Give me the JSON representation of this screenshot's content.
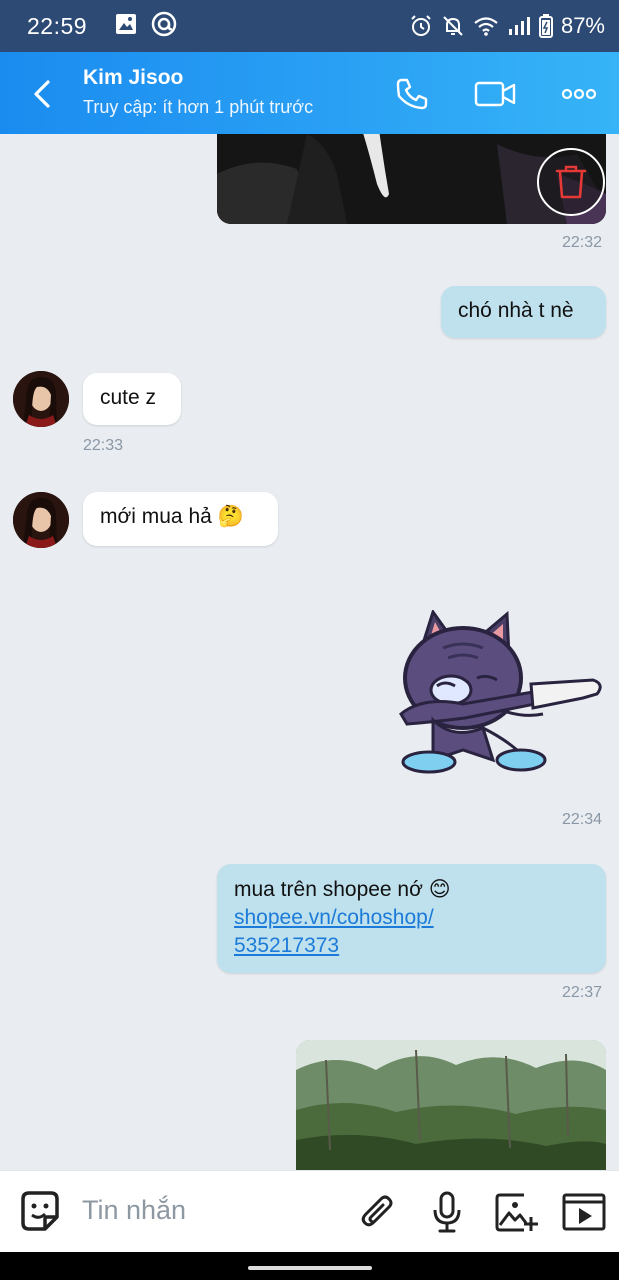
{
  "status_bar": {
    "time": "22:59",
    "battery": "87%",
    "icons": [
      "gallery-icon",
      "at-sign-icon",
      "alarm-icon",
      "mute-icon",
      "wifi-icon",
      "signal-icon",
      "battery-icon"
    ]
  },
  "header": {
    "contact_name": "Kim Jisoo",
    "last_seen": "Truy cập: ít hơn 1 phút trước",
    "icons": [
      "back-arrow-icon",
      "phone-icon",
      "video-call-icon",
      "more-options-icon"
    ]
  },
  "messages": [
    {
      "type": "image",
      "direction": "out",
      "time": "22:32"
    },
    {
      "type": "text",
      "direction": "out",
      "text": "chó nhà t nè"
    },
    {
      "type": "text",
      "direction": "in",
      "text": "cute z",
      "time": "22:33"
    },
    {
      "type": "text",
      "direction": "in",
      "text": "mới mua hả 🤔"
    },
    {
      "type": "sticker",
      "direction": "in",
      "time": "22:34"
    },
    {
      "type": "text",
      "direction": "out",
      "text": "mua trên shopee nớ 😊",
      "link_line1": "shopee.vn/cohoshop/",
      "link_line2": "535217373",
      "time": "22:37"
    },
    {
      "type": "image",
      "direction": "out"
    }
  ],
  "input_bar": {
    "placeholder": "Tin nhắn",
    "icons": [
      "sticker-icon",
      "attachment-icon",
      "microphone-icon",
      "add-image-icon",
      "video-icon"
    ]
  },
  "colors": {
    "status_bar": "#2c4a74",
    "header_start": "#1a8cf0",
    "header_end": "#36b4f7",
    "chat_background": "#e9edf1",
    "outgoing_bubble": "#bfe1ee",
    "incoming_bubble": "#ffffff",
    "link": "#1c7bd8"
  }
}
